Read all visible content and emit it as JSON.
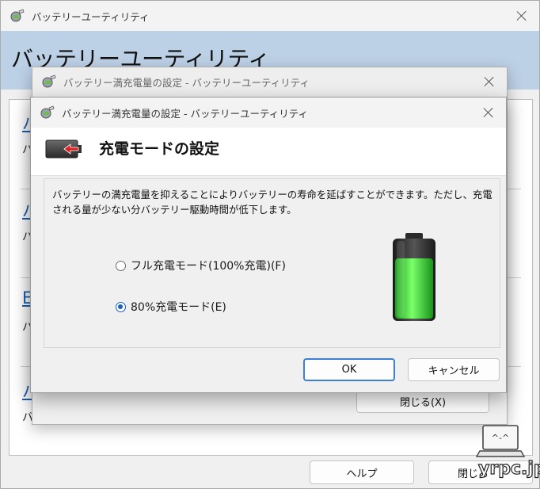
{
  "main_window": {
    "title": "バッテリーユーティリティ",
    "banner_title": "バッテリーユーティリティ",
    "rows": [
      {
        "link": "バ",
        "text": "バ"
      },
      {
        "link": "バ",
        "text": "バ"
      },
      {
        "link": "E",
        "text": "バ"
      },
      {
        "link": "バ",
        "text": "バ"
      }
    ],
    "close_button": "閉じる(X)",
    "help_button": "ヘルプ",
    "bottom_close_button": "閉じる"
  },
  "back_dialog": {
    "title": "バッテリー満充電量の設定 - バッテリーユーティリティ"
  },
  "dialog": {
    "title": "バッテリー満充電量の設定 - バッテリーユーティリティ",
    "header": "充電モードの設定",
    "description": "バッテリーの満充電量を抑えることによりバッテリーの寿命を延ばすことができます。ただし、充電される量が少ない分バッテリー駆動時間が低下します。",
    "options": [
      {
        "label": "フル充電モード(100%充電)(F)",
        "selected": false
      },
      {
        "label": "80%充電モード(E)",
        "selected": true
      }
    ],
    "battery_level": 0.8,
    "ok_button": "OK",
    "cancel_button": "キャンセル"
  },
  "watermark": "yrpc.jp",
  "colors": {
    "accent": "#3c7fd6",
    "link": "#1a5fb4",
    "banner": "#bcd0e6",
    "battery_green": "#2ecf2e"
  }
}
